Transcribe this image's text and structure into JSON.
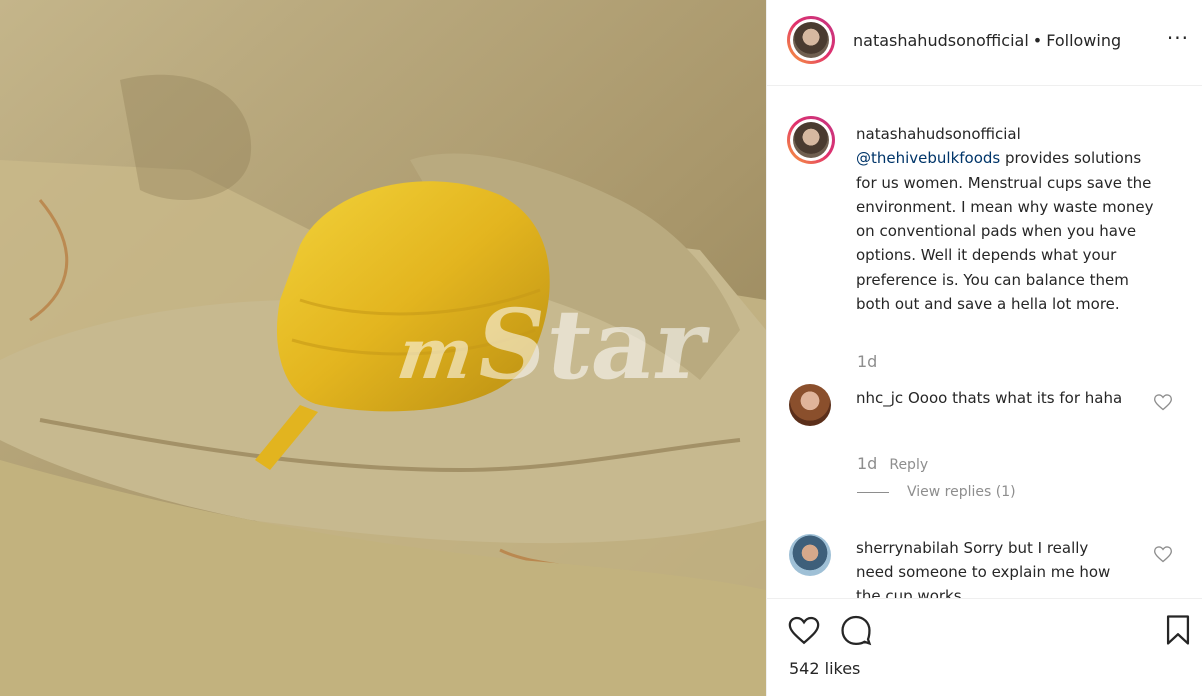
{
  "post": {
    "username": "natashahudsonofficial",
    "separator": "•",
    "follow_status": "Following",
    "more_label": "···"
  },
  "watermark": {
    "m": "m",
    "text": "Star"
  },
  "caption": {
    "author": "natashahudsonofficial",
    "mention": "@thehivebulkfoods",
    "text": " provides solutions for us women. Menstrual cups save the environment. I mean why waste money on conventional pads when you have options. Well it depends what your preference is. You can balance them both out and save a hella lot more.",
    "time": "1d"
  },
  "comments": [
    {
      "username": "nhc_jc",
      "text": "Oooo thats what its for haha",
      "time": "1d",
      "reply_label": "Reply",
      "view_replies": "View replies (1)"
    },
    {
      "username": "sherrynabilah",
      "text": "Sorry but I really need someone to explain me how the cup works"
    }
  ],
  "actions": {
    "likes": "542 likes"
  },
  "icons": [
    "more-options-icon",
    "heart-icon",
    "comment-icon",
    "bookmark-icon"
  ]
}
